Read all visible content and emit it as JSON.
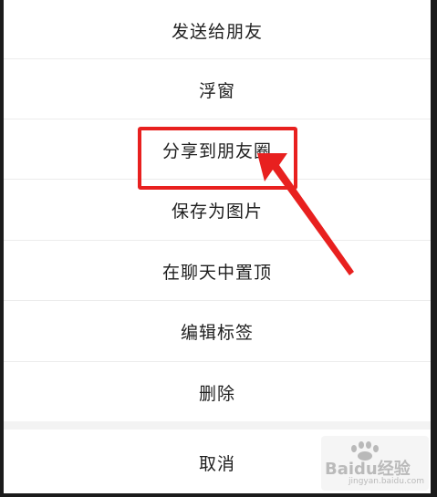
{
  "menu": {
    "items": [
      {
        "label": "发送给朋友"
      },
      {
        "label": "浮窗"
      },
      {
        "label": "分享到朋友圈"
      },
      {
        "label": "保存为图片"
      },
      {
        "label": "在聊天中置顶"
      },
      {
        "label": "编辑标签"
      },
      {
        "label": "删除"
      }
    ],
    "cancel_label": "取消"
  },
  "annotation": {
    "highlight_color": "#e8201f"
  },
  "watermark": {
    "brand": "Baidu经验",
    "url": "jingyan.baidu.com"
  }
}
